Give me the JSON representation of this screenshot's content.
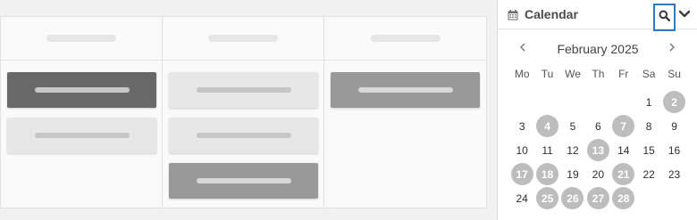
{
  "calendar": {
    "title": "Calendar",
    "month_label": "February 2025",
    "weekdays": [
      "Mo",
      "Tu",
      "We",
      "Th",
      "Fr",
      "Sa",
      "Su"
    ],
    "highlight_color": "#bdbdbd",
    "weeks": [
      [
        {
          "d": ""
        },
        {
          "d": ""
        },
        {
          "d": ""
        },
        {
          "d": ""
        },
        {
          "d": ""
        },
        {
          "d": "1"
        },
        {
          "d": "2",
          "hl": true
        }
      ],
      [
        {
          "d": "3"
        },
        {
          "d": "4",
          "hl": true
        },
        {
          "d": "5"
        },
        {
          "d": "6"
        },
        {
          "d": "7",
          "hl": true
        },
        {
          "d": "8"
        },
        {
          "d": "9"
        }
      ],
      [
        {
          "d": "10"
        },
        {
          "d": "11"
        },
        {
          "d": "12"
        },
        {
          "d": "13",
          "hl": true
        },
        {
          "d": "14"
        },
        {
          "d": "15"
        },
        {
          "d": "16"
        }
      ],
      [
        {
          "d": "17",
          "hl": true
        },
        {
          "d": "18",
          "hl": true
        },
        {
          "d": "19"
        },
        {
          "d": "20"
        },
        {
          "d": "21",
          "hl": true
        },
        {
          "d": "22"
        },
        {
          "d": "23"
        }
      ],
      [
        {
          "d": "24"
        },
        {
          "d": "25",
          "hl": true
        },
        {
          "d": "26",
          "hl": true
        },
        {
          "d": "27",
          "hl": true
        },
        {
          "d": "28",
          "hl": true
        },
        {
          "d": ""
        },
        {
          "d": ""
        }
      ]
    ],
    "icons": {
      "calendar": "calendar-icon",
      "search": "search-icon",
      "expand": "chevron-down-icon",
      "prev": "chevron-left-icon",
      "next": "chevron-right-icon"
    },
    "accent": "#2e7bc4"
  },
  "board": {
    "column_count": 3,
    "card_colors": {
      "dark": "#686868",
      "light": "#e7e7e7",
      "mid": "#999999"
    }
  }
}
